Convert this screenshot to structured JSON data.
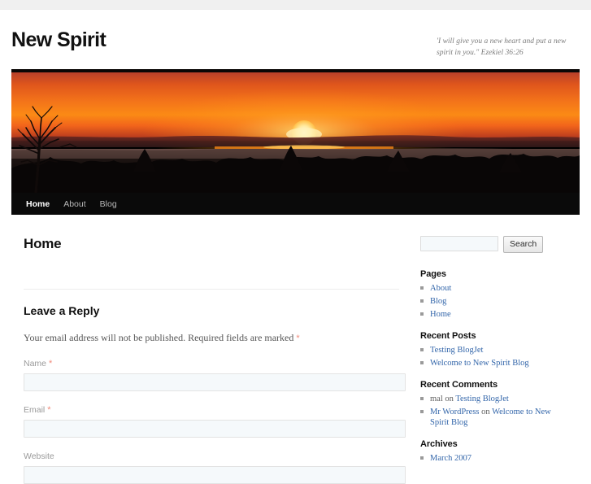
{
  "site": {
    "title": "New Spirit",
    "description": "'I will give you a new heart and put a new spirit in you.\" Ezekiel 36:26"
  },
  "nav": {
    "items": [
      {
        "label": "Home",
        "current": true
      },
      {
        "label": "About",
        "current": false
      },
      {
        "label": "Blog",
        "current": false
      }
    ]
  },
  "banner": {
    "alt": "sunset-over-treeline-photo",
    "colors": {
      "sky_top": "#c9492b",
      "sky_mid": "#f7761a",
      "sky_glow": "#ffa21e",
      "sun": "#fff3c0",
      "horizon": "#7a2a22",
      "ground": "#0b0909",
      "tree": "#140c0a"
    }
  },
  "main": {
    "page_title": "Home",
    "reply_title": "Leave a Reply",
    "comment_notes": "Your email address will not be published. Required fields are marked",
    "required_mark": "*",
    "fields": [
      {
        "label": "Name",
        "required": true,
        "value": "",
        "placeholder": ""
      },
      {
        "label": "Email",
        "required": true,
        "value": "",
        "placeholder": ""
      },
      {
        "label": "Website",
        "required": false,
        "value": "",
        "placeholder": ""
      }
    ]
  },
  "sidebar": {
    "search": {
      "value": "",
      "placeholder": "",
      "button_label": "Search"
    },
    "widgets": [
      {
        "title": "Pages",
        "items": [
          {
            "parts": [
              {
                "text": "About",
                "link": true
              }
            ]
          },
          {
            "parts": [
              {
                "text": "Blog",
                "link": true
              }
            ]
          },
          {
            "parts": [
              {
                "text": "Home",
                "link": true
              }
            ]
          }
        ]
      },
      {
        "title": "Recent Posts",
        "items": [
          {
            "parts": [
              {
                "text": "Testing BlogJet",
                "link": true
              }
            ]
          },
          {
            "parts": [
              {
                "text": "Welcome to New Spirit Blog",
                "link": true
              }
            ]
          }
        ]
      },
      {
        "title": "Recent Comments",
        "items": [
          {
            "parts": [
              {
                "text": "mal",
                "link": false
              },
              {
                "text": " on ",
                "link": false
              },
              {
                "text": "Testing BlogJet",
                "link": true
              }
            ]
          },
          {
            "parts": [
              {
                "text": "Mr WordPress",
                "link": true
              },
              {
                "text": " on ",
                "link": false
              },
              {
                "text": "Welcome to New Spirit Blog",
                "link": true
              }
            ]
          }
        ]
      },
      {
        "title": "Archives",
        "items": [
          {
            "parts": [
              {
                "text": "March 2007",
                "link": true
              }
            ]
          }
        ]
      }
    ]
  }
}
